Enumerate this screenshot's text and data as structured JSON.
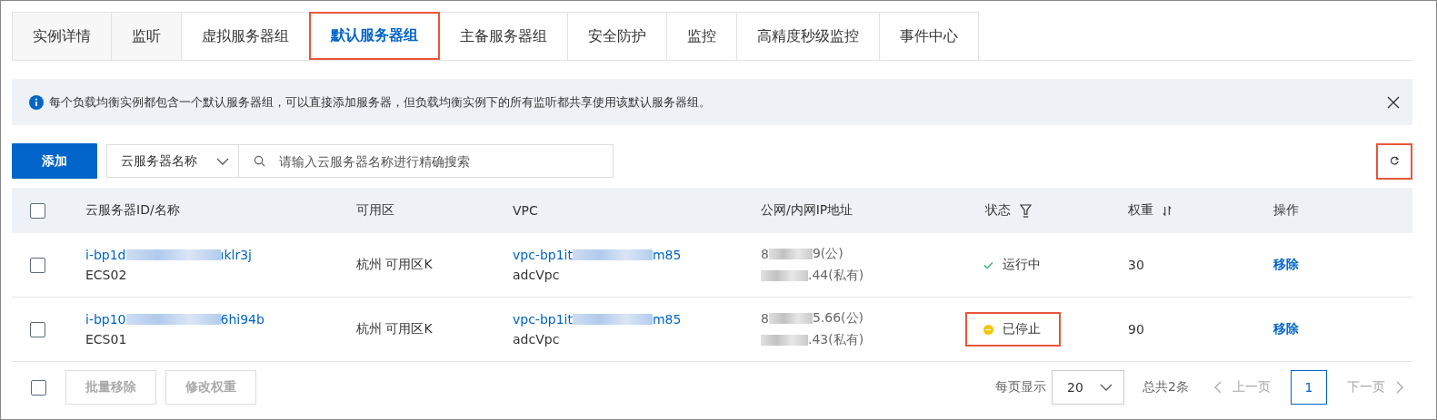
{
  "tabs": [
    {
      "label": "实例详情",
      "selected": false,
      "highlighted": false
    },
    {
      "label": "监听",
      "selected": false,
      "highlighted": false
    },
    {
      "label": "虚拟服务器组",
      "selected": false,
      "highlighted": false
    },
    {
      "label": "默认服务器组",
      "selected": true,
      "highlighted": true
    },
    {
      "label": "主备服务器组",
      "selected": false,
      "highlighted": false
    },
    {
      "label": "安全防护",
      "selected": false,
      "highlighted": false
    },
    {
      "label": "监控",
      "selected": false,
      "highlighted": false
    },
    {
      "label": "高精度秒级监控",
      "selected": false,
      "highlighted": false
    },
    {
      "label": "事件中心",
      "selected": false,
      "highlighted": false
    }
  ],
  "alert": {
    "text": "每个负载均衡实例都包含一个默认服务器组，可以直接添加服务器，但负载均衡实例下的所有监听都共享使用该默认服务器组。"
  },
  "toolbar": {
    "add_button": "添加",
    "filter_select": "云服务器名称",
    "search": {
      "placeholder": "请输入云服务器名称进行精确搜索"
    },
    "refresh_highlighted": true
  },
  "table": {
    "header_checked": false,
    "columns": [
      "云服务器ID/名称",
      "可用区",
      "VPC",
      "公网/内网IP地址",
      "状态",
      "权重",
      "操作"
    ],
    "rows": [
      {
        "checked": false,
        "id_visible_start": "i-bp1d",
        "id_visible_end": "ıklr3j",
        "name": "ECS02",
        "zone": "杭州 可用区K",
        "vpc_visible_start": "vpc-bp1it",
        "vpc_visible_end": "m85",
        "vpc_name": "adcVpc",
        "public_ip_visible_start": "8",
        "public_ip_visible_end": "9(公)",
        "private_ip_visible_end": ".44(私有)",
        "status": {
          "kind": "running",
          "label": "运行中",
          "highlighted": false
        },
        "weight": "30",
        "action": "移除"
      },
      {
        "checked": false,
        "id_visible_start": "i-bp10",
        "id_visible_end": "6hi94b",
        "name": "ECS01",
        "zone": "杭州 可用区K",
        "vpc_visible_start": "vpc-bp1it",
        "vpc_visible_end": "m85",
        "vpc_name": "adcVpc",
        "public_ip_visible_start": "8",
        "public_ip_visible_end": "5.66(公)",
        "private_ip_visible_end": ".43(私有)",
        "status": {
          "kind": "stopped",
          "label": "已停止",
          "highlighted": true
        },
        "weight": "90",
        "action": "移除"
      }
    ]
  },
  "footer": {
    "select_all_checked": false,
    "buttons": [
      {
        "label": "批量移除",
        "disabled": true
      },
      {
        "label": "修改权重",
        "disabled": true
      }
    ],
    "page_size_label": "每页显示",
    "page_size": "20",
    "total": "总共2条",
    "prev": {
      "label": "上一页",
      "disabled": true
    },
    "pages": [
      {
        "label": "1",
        "selected": true
      }
    ],
    "next": {
      "label": "下一页",
      "disabled": true
    }
  }
}
